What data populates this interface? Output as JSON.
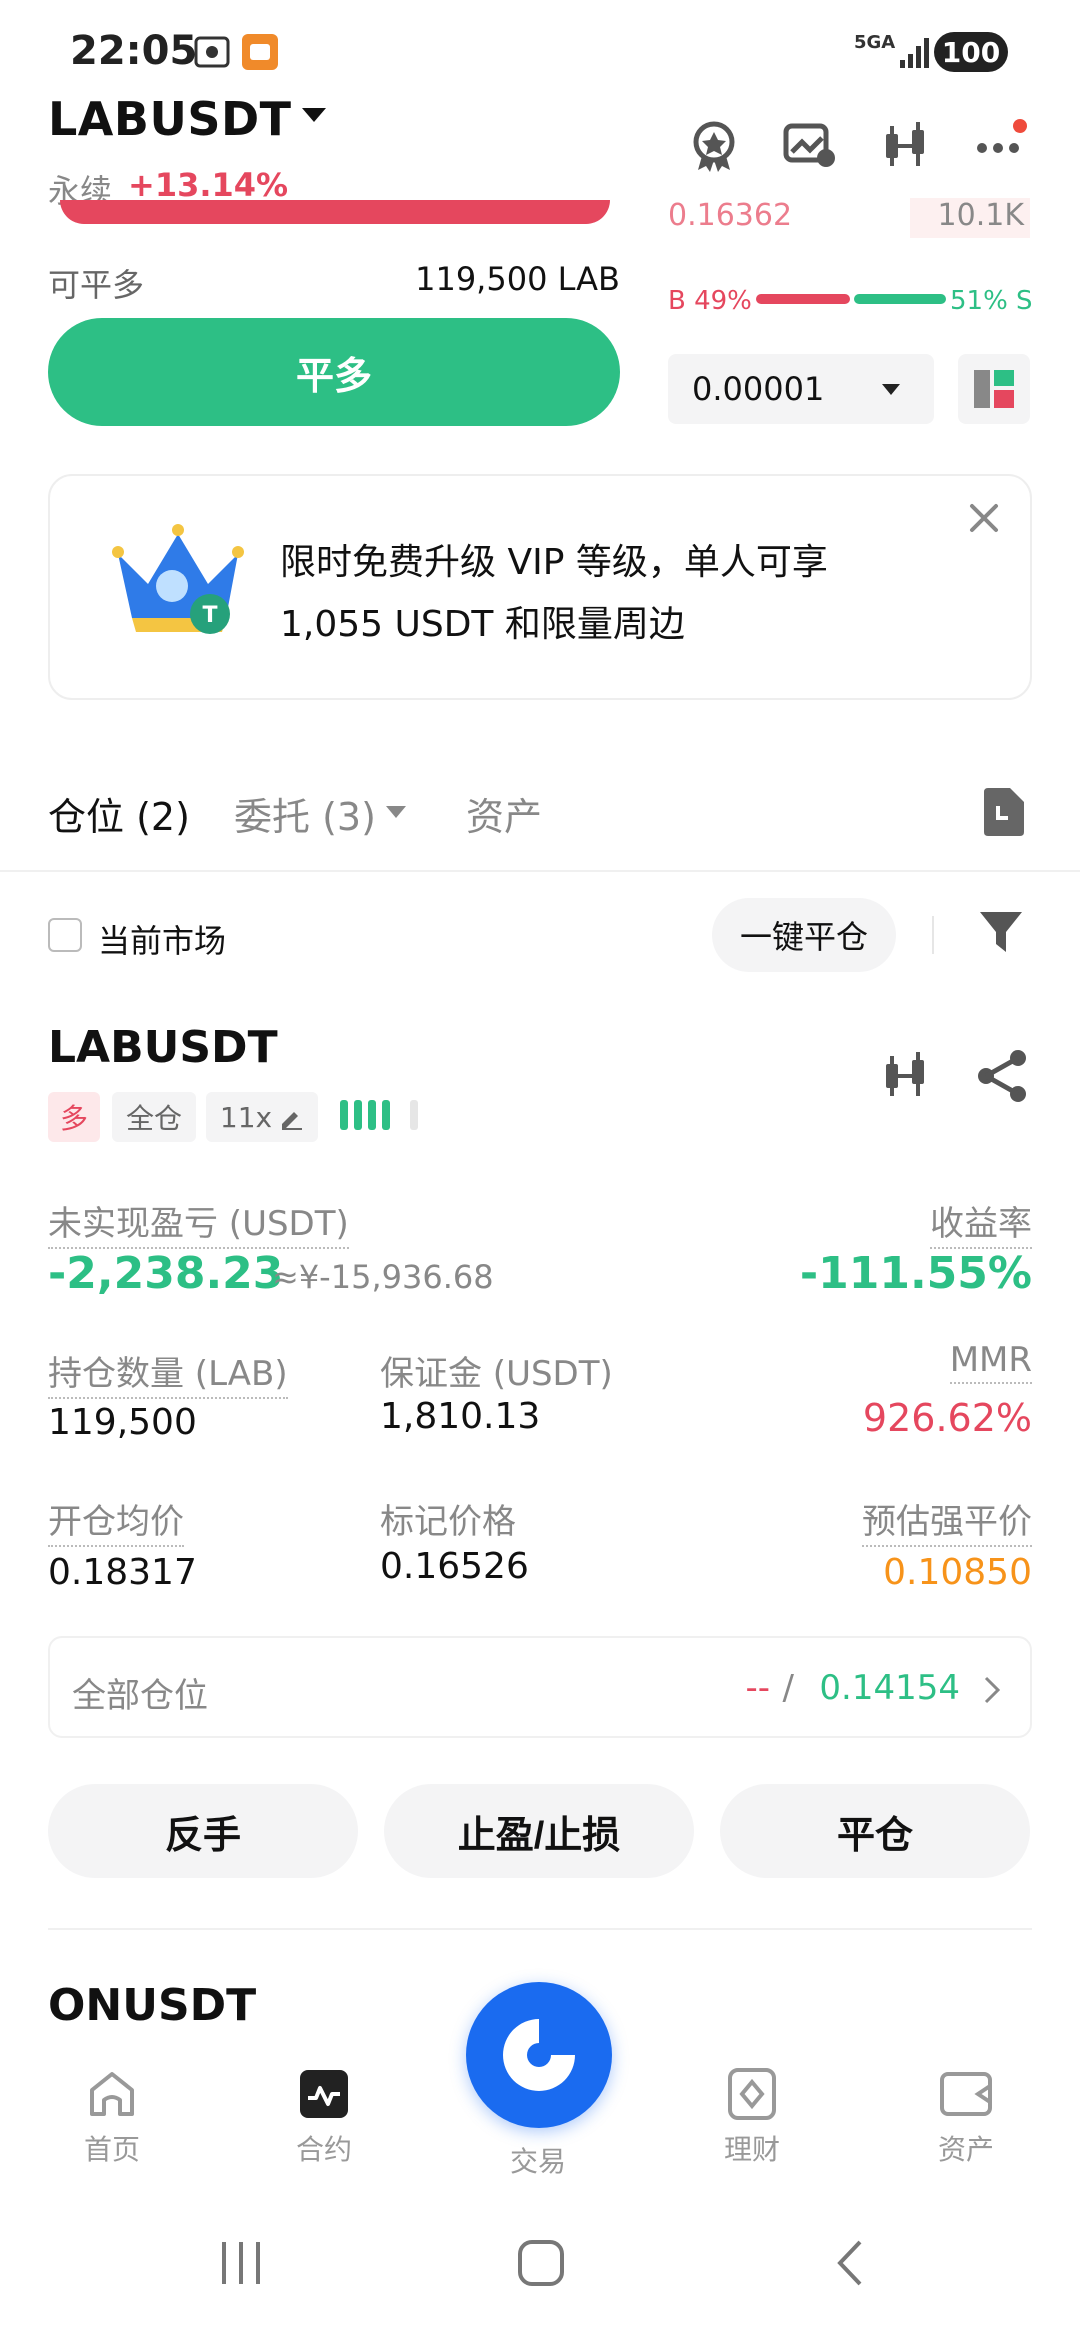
{
  "status_bar": {
    "time": "22:05",
    "battery": "100",
    "network": "5GA"
  },
  "header": {
    "pair": "LABUSDT",
    "contract_type": "永续",
    "change": "+13.14%"
  },
  "order_panel": {
    "orderbook_partial_price": "0.16362",
    "orderbook_partial_qty": "10.1K",
    "can_close_label": "可平多",
    "can_close_value": "119,500 LAB",
    "close_long_button": "平多",
    "buy_ratio": "B 49%",
    "sell_ratio": "51% S",
    "precision": "0.00001"
  },
  "promo": {
    "line1": "限时免费升级 VIP 等级，单人可享",
    "line2": "1,055 USDT 和限量周边"
  },
  "tabs": [
    {
      "label": "仓位 (2)"
    },
    {
      "label": "委托 (3)"
    },
    {
      "label": "资产"
    }
  ],
  "filter": {
    "current_market": "当前市场",
    "close_all": "一键平仓"
  },
  "position": {
    "symbol": "LABUSDT",
    "side": "多",
    "margin_mode": "全仓",
    "leverage": "11x",
    "unrealized_pnl_label": "未实现盈亏 (USDT)",
    "unrealized_pnl": "-2,238.23",
    "unrealized_pnl_cny": "≈¥-15,936.68",
    "roe_label": "收益率",
    "roe": "-111.55%",
    "size_label": "持仓数量 (LAB)",
    "size": "119,500",
    "margin_label": "保证金 (USDT)",
    "margin": "1,810.13",
    "mmr_label": "MMR",
    "mmr": "926.62%",
    "entry_label": "开仓均价",
    "entry": "0.18317",
    "mark_label": "标记价格",
    "mark": "0.16526",
    "liq_label": "预估强平价",
    "liq": "0.10850",
    "all_positions_label": "全部仓位",
    "all_positions_dash": "--",
    "all_positions_slash": "/",
    "all_positions_value": "0.14154",
    "actions": [
      "反手",
      "止盈/止损",
      "平仓"
    ]
  },
  "next_position": {
    "symbol": "ONUSDT"
  },
  "bottom_nav": [
    {
      "label": "首页",
      "icon": "home-icon"
    },
    {
      "label": "合约",
      "icon": "futures-icon"
    },
    {
      "label": "交易",
      "icon": "trade-logo-icon"
    },
    {
      "label": "理财",
      "icon": "earn-icon"
    },
    {
      "label": "资产",
      "icon": "wallet-icon"
    }
  ],
  "colors": {
    "green": "#2dbf85",
    "red": "#e5475e",
    "orange": "#f7931a",
    "blue": "#1a6bf0"
  }
}
